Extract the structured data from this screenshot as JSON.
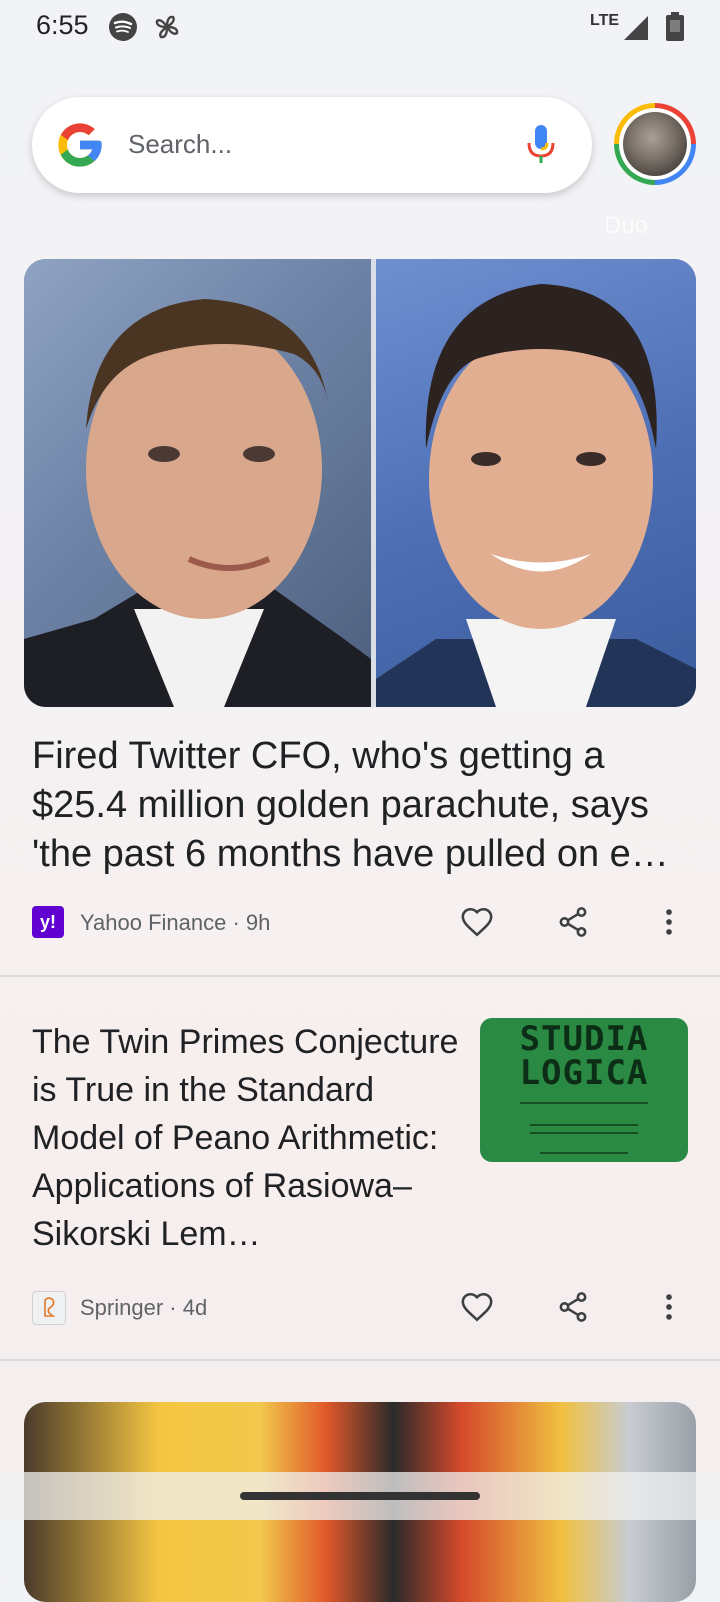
{
  "status_bar": {
    "time": "6:55",
    "network": "LTE",
    "left_icons": [
      "spotify-icon",
      "pinwheel-icon"
    ],
    "right_icons": [
      "signal-icon",
      "battery-icon"
    ]
  },
  "search": {
    "placeholder": "Search..."
  },
  "background_app_label": "Duo",
  "feed": [
    {
      "title": "Fired Twitter CFO, who's getting a $25.4 million golden parachute, says 'the past 6 months have pulled on e…",
      "source": "Yahoo Finance",
      "age": "9h",
      "source_line": "Yahoo Finance · 9h",
      "logo_text": "y!",
      "logo_color": "#6001d2"
    },
    {
      "title": "The Twin Primes Conjecture is True in the Standard Model of Peano Arithmetic: Applications of Rasiowa–Sikorski Lem…",
      "source": "Springer",
      "age": "4d",
      "source_line": "Springer · 4d",
      "thumbnail_text": "STUDIA LOGICA",
      "thumbnail_color": "#2a8a43"
    }
  ],
  "colors": {
    "google_blue": "#4285f4",
    "google_red": "#ea4335",
    "google_yellow": "#fbbc05",
    "google_green": "#34a853"
  }
}
